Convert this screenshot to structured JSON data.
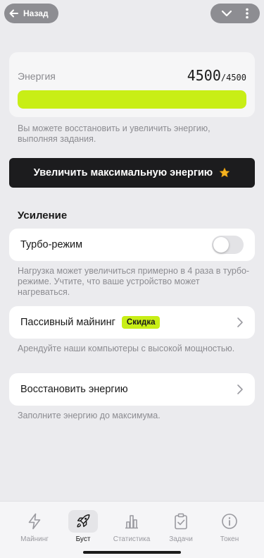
{
  "header": {
    "back_label": "Назад"
  },
  "energy": {
    "label": "Энергия",
    "current": "4500",
    "max": "/4500",
    "fill_fraction": 1.0,
    "hint": "Вы можете восстановить и увеличить энергию, выполняя задания."
  },
  "boost_button": {
    "label": "Увеличить максимальную энергию"
  },
  "section": {
    "title": "Усиление"
  },
  "turbo": {
    "label": "Турбо-режим",
    "enabled": false,
    "hint": "Нагрузка может увеличиться примерно в 4 раза в турбо-режиме. Учтите, что ваше устройство может нагреваться."
  },
  "passive": {
    "label": "Пассивный майнинг",
    "badge": "Скидка",
    "hint": "Арендуйте наши компьютеры с высокой мощностью."
  },
  "restore": {
    "label": "Восстановить энергию",
    "hint": "Заполните энергию до максимума."
  },
  "tabs": [
    {
      "label": "Майнинг",
      "icon": "lightning-icon"
    },
    {
      "label": "Буст",
      "icon": "rocket-icon",
      "active": true
    },
    {
      "label": "Статистика",
      "icon": "chart-icon"
    },
    {
      "label": "Задачи",
      "icon": "clipboard-icon"
    },
    {
      "label": "Токен",
      "icon": "info-icon"
    }
  ],
  "colors": {
    "accent": "#c8ee16",
    "dark_button": "#1c1c1e",
    "background": "#ebebee"
  }
}
